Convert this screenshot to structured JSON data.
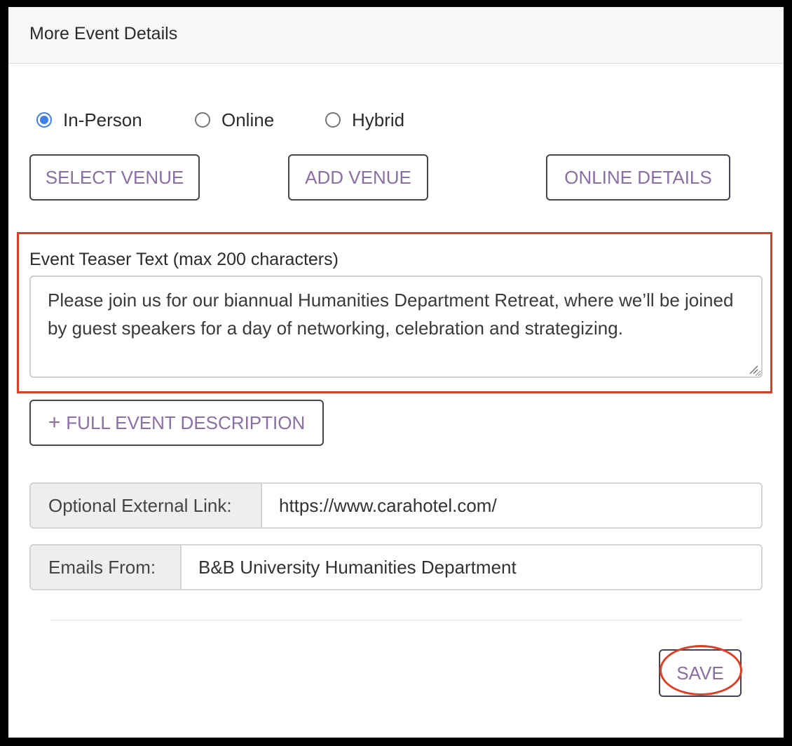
{
  "panel": {
    "title": "More Event Details"
  },
  "event_type": {
    "options": [
      {
        "label": "In-Person",
        "checked": true
      },
      {
        "label": "Online",
        "checked": false
      },
      {
        "label": "Hybrid",
        "checked": false
      }
    ]
  },
  "venue_buttons": {
    "select_venue": "SELECT VENUE",
    "add_venue": "ADD VENUE",
    "online_details": "ONLINE DETAILS"
  },
  "teaser": {
    "label": "Event Teaser Text (max 200 characters)",
    "value": "Please join us for our biannual Humanities Department Retreat, where we’ll be joined by guest speakers for a day of networking, celebration and strategizing."
  },
  "full_description_button": {
    "icon": "+",
    "label": "FULL EVENT DESCRIPTION"
  },
  "external_link": {
    "label": "Optional External Link:",
    "value": "https://www.carahotel.com/"
  },
  "emails_from": {
    "label": "Emails From:",
    "value": "B&B University Humanities Department"
  },
  "save_button": {
    "label": "SAVE"
  },
  "colors": {
    "accent_text": "#8c6ea6",
    "annotation": "#e03d22",
    "radio_checked": "#3f7ee8"
  }
}
